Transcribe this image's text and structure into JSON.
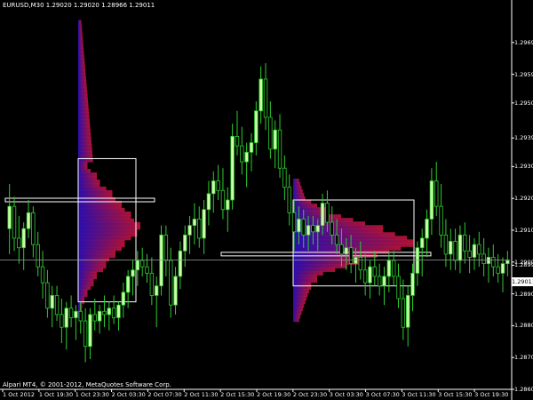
{
  "header": {
    "symbol_info": "EURUSD,M30  1.29020 1.29020 1.28966 1.29011"
  },
  "footer": {
    "copyright": "Alpari MT4, © 2001-2012, MetaQuotes Software Corp."
  },
  "price_axis": {
    "labels": [
      "1.29695",
      "1.29595",
      "1.29505",
      "1.29395",
      "1.29305",
      "1.29205",
      "1.29105",
      "1.29005",
      "1.28995",
      "1.28905",
      "1.28805",
      "1.28705",
      "1.28605"
    ],
    "bid_tag": "1.29011"
  },
  "time_axis": {
    "labels": [
      "1 Oct 2012",
      "1 Oct 19:30",
      "1 Oct 23:30",
      "2 Oct 03:30",
      "2 Oct 07:30",
      "2 Oct 11:30",
      "2 Oct 15:30",
      "2 Oct 19:30",
      "2 Oct 23:30",
      "3 Oct 03:30",
      "3 Oct 07:30",
      "3 Oct 11:30",
      "3 Oct 15:30",
      "3 Oct 19:30"
    ]
  },
  "colors": {
    "background": "#000000",
    "bull_candle": "#ccffaa",
    "wick": "#2ecc2e",
    "bear_candle": "#000000",
    "box_outline": "#ffffff",
    "profile_low": "#3210c8",
    "profile_high": "#c8143c"
  },
  "chart_data": {
    "type": "candlestick",
    "symbol": "EURUSD",
    "timeframe": "M30",
    "ylim": [
      1.28605,
      1.29795
    ],
    "last_price": 1.29011,
    "candles": [
      {
        "o": 1.2911,
        "h": 1.2925,
        "l": 1.2903,
        "c": 1.2918
      },
      {
        "o": 1.2918,
        "h": 1.2921,
        "l": 1.2904,
        "c": 1.2908
      },
      {
        "o": 1.2908,
        "h": 1.2915,
        "l": 1.29,
        "c": 1.2905
      },
      {
        "o": 1.2905,
        "h": 1.2913,
        "l": 1.2898,
        "c": 1.2911
      },
      {
        "o": 1.2911,
        "h": 1.292,
        "l": 1.2908,
        "c": 1.2916
      },
      {
        "o": 1.2916,
        "h": 1.2918,
        "l": 1.2902,
        "c": 1.2906
      },
      {
        "o": 1.2906,
        "h": 1.291,
        "l": 1.2896,
        "c": 1.2899
      },
      {
        "o": 1.2899,
        "h": 1.2904,
        "l": 1.2889,
        "c": 1.2894
      },
      {
        "o": 1.2894,
        "h": 1.2898,
        "l": 1.2883,
        "c": 1.2886
      },
      {
        "o": 1.2886,
        "h": 1.2893,
        "l": 1.288,
        "c": 1.289
      },
      {
        "o": 1.289,
        "h": 1.2893,
        "l": 1.2882,
        "c": 1.2884
      },
      {
        "o": 1.2884,
        "h": 1.2889,
        "l": 1.2875,
        "c": 1.288
      },
      {
        "o": 1.288,
        "h": 1.2888,
        "l": 1.2873,
        "c": 1.2886
      },
      {
        "o": 1.2886,
        "h": 1.289,
        "l": 1.288,
        "c": 1.2883
      },
      {
        "o": 1.2883,
        "h": 1.2887,
        "l": 1.2876,
        "c": 1.2885
      },
      {
        "o": 1.2885,
        "h": 1.2888,
        "l": 1.2878,
        "c": 1.2882
      },
      {
        "o": 1.2882,
        "h": 1.2886,
        "l": 1.2869,
        "c": 1.2874
      },
      {
        "o": 1.2874,
        "h": 1.2886,
        "l": 1.287,
        "c": 1.2884
      },
      {
        "o": 1.2884,
        "h": 1.2889,
        "l": 1.2879,
        "c": 1.2882
      },
      {
        "o": 1.2882,
        "h": 1.2887,
        "l": 1.2878,
        "c": 1.2885
      },
      {
        "o": 1.2885,
        "h": 1.289,
        "l": 1.288,
        "c": 1.2884
      },
      {
        "o": 1.2884,
        "h": 1.2888,
        "l": 1.2879,
        "c": 1.2886
      },
      {
        "o": 1.2886,
        "h": 1.289,
        "l": 1.2881,
        "c": 1.2883
      },
      {
        "o": 1.2883,
        "h": 1.2888,
        "l": 1.2879,
        "c": 1.2887
      },
      {
        "o": 1.2887,
        "h": 1.2894,
        "l": 1.2883,
        "c": 1.2891
      },
      {
        "o": 1.2891,
        "h": 1.2898,
        "l": 1.2886,
        "c": 1.2896
      },
      {
        "o": 1.2896,
        "h": 1.2901,
        "l": 1.289,
        "c": 1.2898
      },
      {
        "o": 1.2898,
        "h": 1.2904,
        "l": 1.2893,
        "c": 1.2901
      },
      {
        "o": 1.2901,
        "h": 1.2905,
        "l": 1.2896,
        "c": 1.2899
      },
      {
        "o": 1.2899,
        "h": 1.2903,
        "l": 1.2894,
        "c": 1.2897
      },
      {
        "o": 1.2897,
        "h": 1.2902,
        "l": 1.2887,
        "c": 1.289
      },
      {
        "o": 1.289,
        "h": 1.2896,
        "l": 1.288,
        "c": 1.2893
      },
      {
        "o": 1.2893,
        "h": 1.2912,
        "l": 1.289,
        "c": 1.2909
      },
      {
        "o": 1.2909,
        "h": 1.2912,
        "l": 1.2896,
        "c": 1.2901
      },
      {
        "o": 1.2901,
        "h": 1.2905,
        "l": 1.2883,
        "c": 1.2887
      },
      {
        "o": 1.2887,
        "h": 1.2899,
        "l": 1.2884,
        "c": 1.2896
      },
      {
        "o": 1.2896,
        "h": 1.2907,
        "l": 1.2892,
        "c": 1.2904
      },
      {
        "o": 1.2904,
        "h": 1.2912,
        "l": 1.2899,
        "c": 1.2909
      },
      {
        "o": 1.2909,
        "h": 1.2915,
        "l": 1.2903,
        "c": 1.2912
      },
      {
        "o": 1.2912,
        "h": 1.2919,
        "l": 1.2906,
        "c": 1.2914
      },
      {
        "o": 1.2914,
        "h": 1.2918,
        "l": 1.2905,
        "c": 1.2908
      },
      {
        "o": 1.2908,
        "h": 1.292,
        "l": 1.2903,
        "c": 1.2917
      },
      {
        "o": 1.2917,
        "h": 1.2926,
        "l": 1.2912,
        "c": 1.2922
      },
      {
        "o": 1.2922,
        "h": 1.2929,
        "l": 1.2916,
        "c": 1.2926
      },
      {
        "o": 1.2926,
        "h": 1.2931,
        "l": 1.292,
        "c": 1.2923
      },
      {
        "o": 1.2923,
        "h": 1.293,
        "l": 1.2914,
        "c": 1.2917
      },
      {
        "o": 1.2917,
        "h": 1.2924,
        "l": 1.291,
        "c": 1.292
      },
      {
        "o": 1.292,
        "h": 1.2944,
        "l": 1.2917,
        "c": 1.294
      },
      {
        "o": 1.294,
        "h": 1.2948,
        "l": 1.2934,
        "c": 1.2937
      },
      {
        "o": 1.2937,
        "h": 1.2943,
        "l": 1.2928,
        "c": 1.2932
      },
      {
        "o": 1.2932,
        "h": 1.2938,
        "l": 1.2924,
        "c": 1.2935
      },
      {
        "o": 1.2935,
        "h": 1.2941,
        "l": 1.2929,
        "c": 1.2938
      },
      {
        "o": 1.2938,
        "h": 1.2951,
        "l": 1.2934,
        "c": 1.2948
      },
      {
        "o": 1.2948,
        "h": 1.2962,
        "l": 1.2944,
        "c": 1.2958
      },
      {
        "o": 1.2958,
        "h": 1.2963,
        "l": 1.2942,
        "c": 1.2946
      },
      {
        "o": 1.2946,
        "h": 1.2951,
        "l": 1.2933,
        "c": 1.2936
      },
      {
        "o": 1.2936,
        "h": 1.2945,
        "l": 1.293,
        "c": 1.2942
      },
      {
        "o": 1.2942,
        "h": 1.2947,
        "l": 1.2927,
        "c": 1.293
      },
      {
        "o": 1.293,
        "h": 1.2934,
        "l": 1.292,
        "c": 1.2924
      },
      {
        "o": 1.2924,
        "h": 1.2928,
        "l": 1.2912,
        "c": 1.2916
      },
      {
        "o": 1.2916,
        "h": 1.292,
        "l": 1.2904,
        "c": 1.291
      },
      {
        "o": 1.291,
        "h": 1.2918,
        "l": 1.2906,
        "c": 1.2914
      },
      {
        "o": 1.2914,
        "h": 1.2917,
        "l": 1.2905,
        "c": 1.2909
      },
      {
        "o": 1.2909,
        "h": 1.2915,
        "l": 1.2904,
        "c": 1.2912
      },
      {
        "o": 1.2912,
        "h": 1.2915,
        "l": 1.2906,
        "c": 1.291
      },
      {
        "o": 1.291,
        "h": 1.2914,
        "l": 1.2904,
        "c": 1.2912
      },
      {
        "o": 1.2912,
        "h": 1.2922,
        "l": 1.2909,
        "c": 1.2919
      },
      {
        "o": 1.2919,
        "h": 1.2923,
        "l": 1.291,
        "c": 1.2913
      },
      {
        "o": 1.2913,
        "h": 1.2918,
        "l": 1.2906,
        "c": 1.2909
      },
      {
        "o": 1.2909,
        "h": 1.2914,
        "l": 1.2903,
        "c": 1.2906
      },
      {
        "o": 1.2906,
        "h": 1.2911,
        "l": 1.2899,
        "c": 1.2903
      },
      {
        "o": 1.2903,
        "h": 1.2908,
        "l": 1.2898,
        "c": 1.2905
      },
      {
        "o": 1.2905,
        "h": 1.2909,
        "l": 1.2897,
        "c": 1.29
      },
      {
        "o": 1.29,
        "h": 1.2905,
        "l": 1.2894,
        "c": 1.2902
      },
      {
        "o": 1.2902,
        "h": 1.2907,
        "l": 1.2895,
        "c": 1.2898
      },
      {
        "o": 1.2898,
        "h": 1.2903,
        "l": 1.289,
        "c": 1.2894
      },
      {
        "o": 1.2894,
        "h": 1.2901,
        "l": 1.2889,
        "c": 1.2899
      },
      {
        "o": 1.2899,
        "h": 1.2904,
        "l": 1.2893,
        "c": 1.2896
      },
      {
        "o": 1.2896,
        "h": 1.29,
        "l": 1.289,
        "c": 1.2893
      },
      {
        "o": 1.2893,
        "h": 1.2899,
        "l": 1.2887,
        "c": 1.2896
      },
      {
        "o": 1.2896,
        "h": 1.2904,
        "l": 1.2891,
        "c": 1.2901
      },
      {
        "o": 1.2901,
        "h": 1.2904,
        "l": 1.2893,
        "c": 1.2896
      },
      {
        "o": 1.2896,
        "h": 1.29,
        "l": 1.2886,
        "c": 1.2889
      },
      {
        "o": 1.2889,
        "h": 1.2895,
        "l": 1.2876,
        "c": 1.288
      },
      {
        "o": 1.288,
        "h": 1.2893,
        "l": 1.2874,
        "c": 1.289
      },
      {
        "o": 1.289,
        "h": 1.29,
        "l": 1.2885,
        "c": 1.2897
      },
      {
        "o": 1.2897,
        "h": 1.2907,
        "l": 1.2893,
        "c": 1.2905
      },
      {
        "o": 1.2905,
        "h": 1.2911,
        "l": 1.2896,
        "c": 1.2908
      },
      {
        "o": 1.2908,
        "h": 1.2917,
        "l": 1.2902,
        "c": 1.2914
      },
      {
        "o": 1.2914,
        "h": 1.293,
        "l": 1.2909,
        "c": 1.2926
      },
      {
        "o": 1.2926,
        "h": 1.2932,
        "l": 1.2915,
        "c": 1.2918
      },
      {
        "o": 1.2918,
        "h": 1.2925,
        "l": 1.2905,
        "c": 1.2909
      },
      {
        "o": 1.2909,
        "h": 1.2914,
        "l": 1.2899,
        "c": 1.2903
      },
      {
        "o": 1.2903,
        "h": 1.2911,
        "l": 1.2898,
        "c": 1.2907
      },
      {
        "o": 1.2907,
        "h": 1.2911,
        "l": 1.2898,
        "c": 1.2901
      },
      {
        "o": 1.2901,
        "h": 1.2912,
        "l": 1.2897,
        "c": 1.2909
      },
      {
        "o": 1.2909,
        "h": 1.2913,
        "l": 1.29,
        "c": 1.2904
      },
      {
        "o": 1.2904,
        "h": 1.2909,
        "l": 1.2897,
        "c": 1.2902
      },
      {
        "o": 1.2902,
        "h": 1.2908,
        "l": 1.2898,
        "c": 1.2906
      },
      {
        "o": 1.2906,
        "h": 1.291,
        "l": 1.2899,
        "c": 1.2903
      },
      {
        "o": 1.2903,
        "h": 1.2908,
        "l": 1.2896,
        "c": 1.29
      },
      {
        "o": 1.29,
        "h": 1.2905,
        "l": 1.2894,
        "c": 1.2902
      },
      {
        "o": 1.2902,
        "h": 1.2906,
        "l": 1.2896,
        "c": 1.2899
      },
      {
        "o": 1.2899,
        "h": 1.2903,
        "l": 1.2894,
        "c": 1.2897
      },
      {
        "o": 1.2897,
        "h": 1.2902,
        "l": 1.2891,
        "c": 1.29
      },
      {
        "o": 1.29,
        "h": 1.2904,
        "l": 1.2896,
        "c": 1.2901
      }
    ],
    "volume_profiles": [
      {
        "range_top": 1.2933,
        "range_bottom": 1.2888,
        "poc": 1.292,
        "volumes": [
          0.1,
          0.15,
          0.2,
          0.3,
          0.35,
          0.45,
          0.55,
          0.6,
          0.7,
          0.75,
          0.85,
          0.9,
          1.0,
          0.95,
          0.85,
          0.75,
          0.7,
          0.6,
          0.5,
          0.45,
          0.4,
          0.3,
          0.25,
          0.2,
          0.15,
          0.1
        ]
      },
      {
        "range_top": 1.292,
        "range_bottom": 1.2893,
        "poc": 1.2903,
        "volumes": [
          0.15,
          0.2,
          0.3,
          0.4,
          0.5,
          0.6,
          0.75,
          0.85,
          0.95,
          1.0,
          0.9,
          0.8,
          0.7,
          0.55,
          0.45,
          0.35,
          0.25,
          0.2,
          0.15
        ]
      }
    ]
  }
}
